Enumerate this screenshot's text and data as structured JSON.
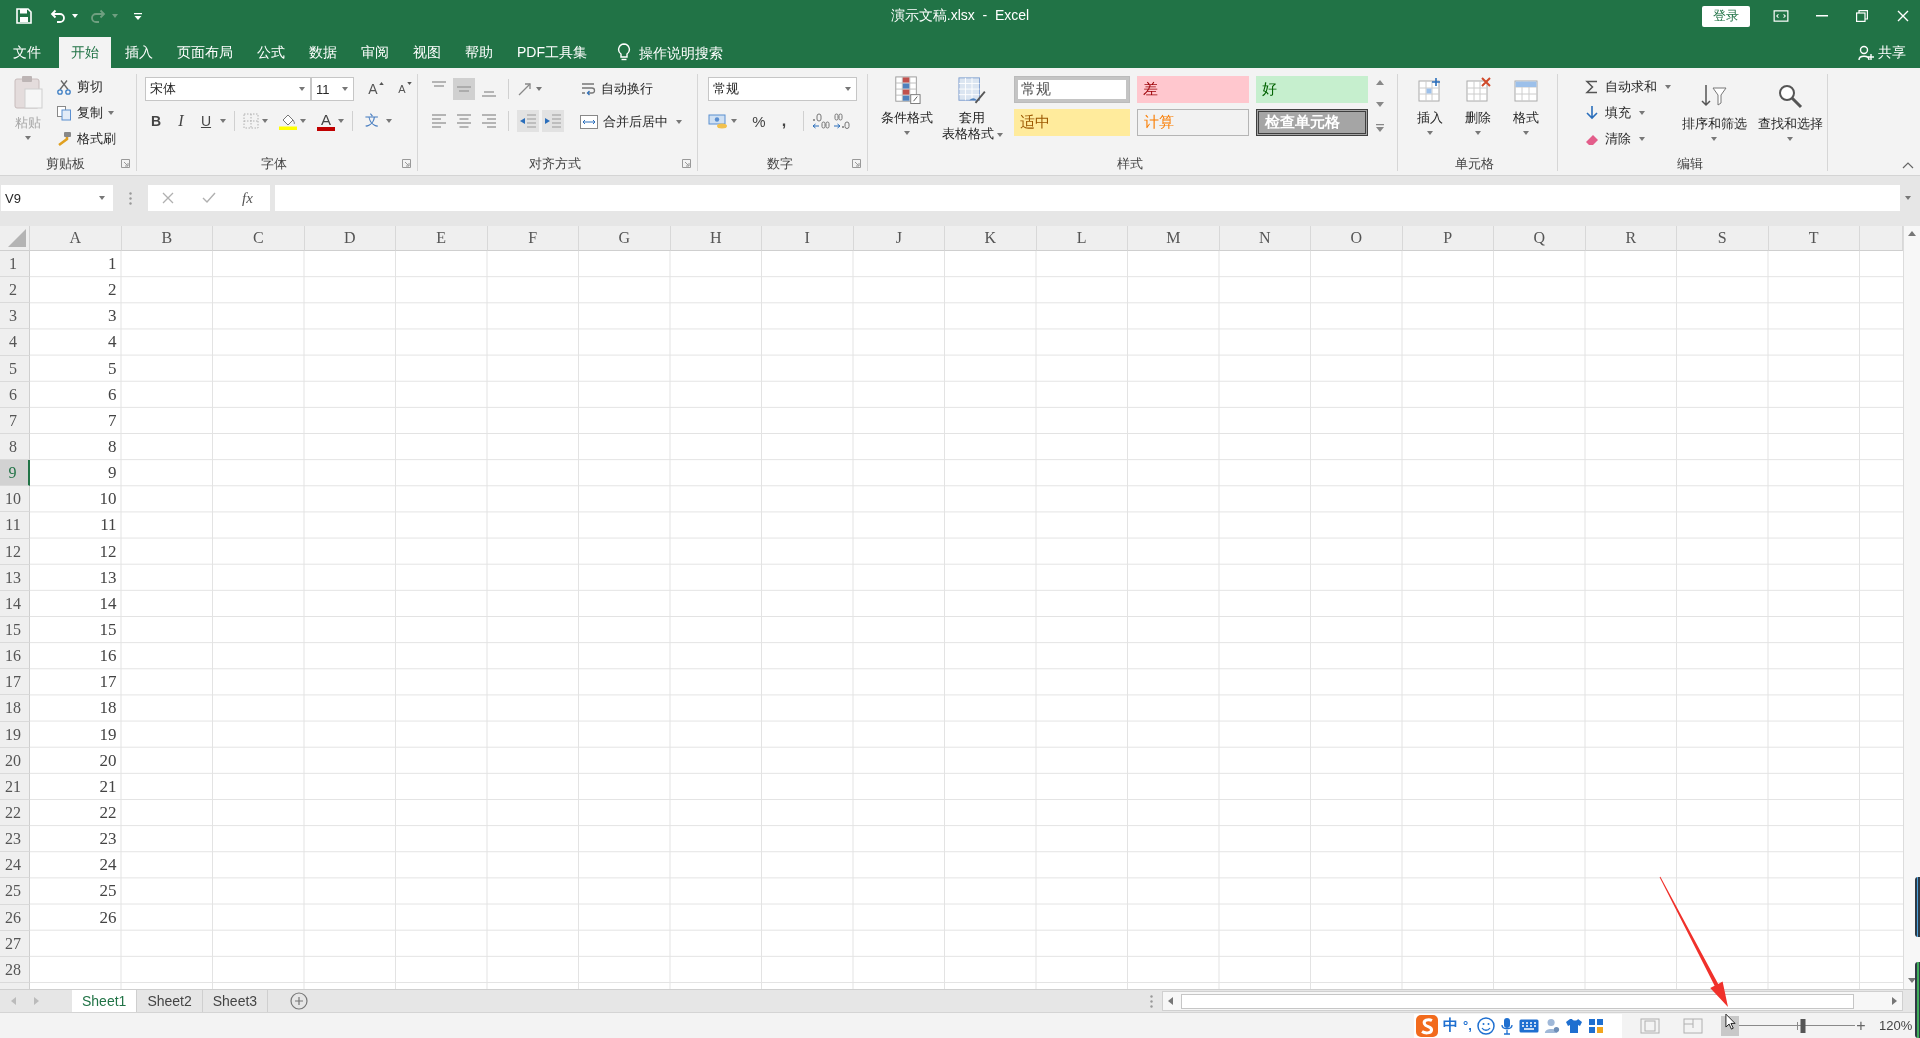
{
  "title_bar": {
    "title": "演示文稿.xlsx  -  Excel",
    "sign_in": "登录"
  },
  "ribbon_tabs": [
    {
      "label": "文件",
      "selected": false
    },
    {
      "label": "开始",
      "selected": true
    },
    {
      "label": "插入",
      "selected": false
    },
    {
      "label": "页面布局",
      "selected": false
    },
    {
      "label": "公式",
      "selected": false
    },
    {
      "label": "数据",
      "selected": false
    },
    {
      "label": "审阅",
      "selected": false
    },
    {
      "label": "视图",
      "selected": false
    },
    {
      "label": "帮助",
      "selected": false
    },
    {
      "label": "PDF工具集",
      "selected": false
    }
  ],
  "tell_me": {
    "placeholder": "操作说明搜索"
  },
  "share": {
    "label": "共享"
  },
  "ribbon": {
    "clipboard": {
      "paste": {
        "label": "粘贴",
        "disabled": true
      },
      "cut": "剪切",
      "copy": "复制",
      "format_painter": "格式刷",
      "label": "剪贴板"
    },
    "font": {
      "name": "宋体",
      "size": "11",
      "grow": "A",
      "shrink": "A",
      "bold": "B",
      "italic": "I",
      "underline": "U",
      "font_color": "A",
      "phonetic": "文",
      "label": "字体"
    },
    "alignment": {
      "vertical": [
        {
          "selected": false
        },
        {
          "selected": true
        },
        {
          "selected": false
        }
      ],
      "wrap_text": "自动换行",
      "merge_center": "合并后居中",
      "label": "对齐方式"
    },
    "number": {
      "format": "常规",
      "percent": "%",
      "comma": ",",
      "label": "数字"
    },
    "styles": {
      "conditional": "条件格式",
      "table_format": [
        "套用",
        "表格格式"
      ],
      "gallery": [
        {
          "label": "常规",
          "kind": "normal",
          "selected": true
        },
        {
          "label": "差",
          "kind": "bad",
          "selected": false
        },
        {
          "label": "好",
          "kind": "good",
          "selected": false
        },
        {
          "label": "适中",
          "kind": "neutral",
          "selected": false
        },
        {
          "label": "计算",
          "kind": "calculation",
          "selected": false
        },
        {
          "label": "检查单元格",
          "kind": "check",
          "selected": false
        }
      ],
      "label": "样式"
    },
    "cells": {
      "insert": "插入",
      "delete": "删除",
      "format": "格式",
      "label": "单元格"
    },
    "editing": {
      "autosum": "自动求和",
      "fill": "填充",
      "clear": "清除",
      "sort_filter": "排序和筛选",
      "find_select": "查找和选择",
      "label": "编辑"
    }
  },
  "formula_bar": {
    "name_box": "V9",
    "function_label": "fx"
  },
  "sheet": {
    "columns": [
      "A",
      "B",
      "C",
      "D",
      "E",
      "F",
      "G",
      "H",
      "I",
      "J",
      "K",
      "L",
      "M",
      "N",
      "O",
      "P",
      "Q",
      "R",
      "S",
      "T"
    ],
    "rows": [
      {
        "number": "1",
        "cells": [
          "1"
        ],
        "selected": false
      },
      {
        "number": "2",
        "cells": [
          "2"
        ],
        "selected": false
      },
      {
        "number": "3",
        "cells": [
          "3"
        ],
        "selected": false
      },
      {
        "number": "4",
        "cells": [
          "4"
        ],
        "selected": false
      },
      {
        "number": "5",
        "cells": [
          "5"
        ],
        "selected": false
      },
      {
        "number": "6",
        "cells": [
          "6"
        ],
        "selected": false
      },
      {
        "number": "7",
        "cells": [
          "7"
        ],
        "selected": false
      },
      {
        "number": "8",
        "cells": [
          "8"
        ],
        "selected": false
      },
      {
        "number": "9",
        "cells": [
          "9"
        ],
        "selected": true
      },
      {
        "number": "10",
        "cells": [
          "10"
        ],
        "selected": false
      },
      {
        "number": "11",
        "cells": [
          "11"
        ],
        "selected": false
      },
      {
        "number": "12",
        "cells": [
          "12"
        ],
        "selected": false
      },
      {
        "number": "13",
        "cells": [
          "13"
        ],
        "selected": false
      },
      {
        "number": "14",
        "cells": [
          "14"
        ],
        "selected": false
      },
      {
        "number": "15",
        "cells": [
          "15"
        ],
        "selected": false
      },
      {
        "number": "16",
        "cells": [
          "16"
        ],
        "selected": false
      },
      {
        "number": "17",
        "cells": [
          "17"
        ],
        "selected": false
      },
      {
        "number": "18",
        "cells": [
          "18"
        ],
        "selected": false
      },
      {
        "number": "19",
        "cells": [
          "19"
        ],
        "selected": false
      },
      {
        "number": "20",
        "cells": [
          "20"
        ],
        "selected": false
      },
      {
        "number": "21",
        "cells": [
          "21"
        ],
        "selected": false
      },
      {
        "number": "22",
        "cells": [
          "22"
        ],
        "selected": false
      },
      {
        "number": "23",
        "cells": [
          "23"
        ],
        "selected": false
      },
      {
        "number": "24",
        "cells": [
          "24"
        ],
        "selected": false
      },
      {
        "number": "25",
        "cells": [
          "25"
        ],
        "selected": false
      },
      {
        "number": "26",
        "cells": [
          "26"
        ],
        "selected": false
      },
      {
        "number": "27",
        "selected": false
      },
      {
        "number": "28",
        "selected": false
      }
    ]
  },
  "sheet_tabs": [
    {
      "label": "Sheet1",
      "selected": true
    },
    {
      "label": "Sheet2",
      "selected": false
    },
    {
      "label": "Sheet3",
      "selected": false
    }
  ],
  "status_bar": {
    "ime_mode": "中",
    "ime_punctuation": "°,",
    "zoom_in": "+",
    "zoom": "120%",
    "zoom_slider": {
      "level": 0.55
    }
  }
}
